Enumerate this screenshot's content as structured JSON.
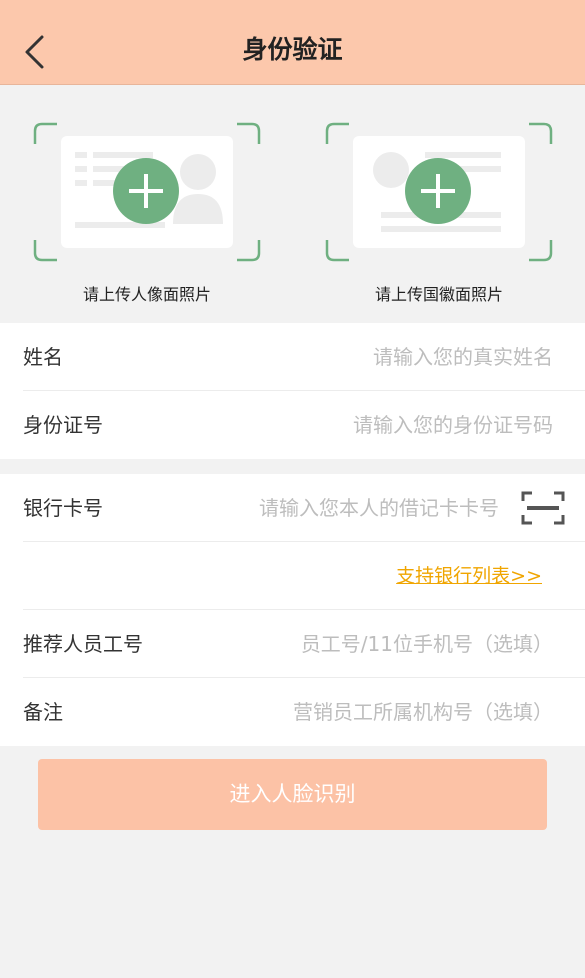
{
  "header": {
    "title": "身份验证"
  },
  "upload": {
    "portrait_label": "请上传人像面照片",
    "emblem_label": "请上传国徽面照片"
  },
  "identity": {
    "name_label": "姓名",
    "name_placeholder": "请输入您的真实姓名",
    "id_label": "身份证号",
    "id_placeholder": "请输入您的身份证号码"
  },
  "bank": {
    "card_label": "银行卡号",
    "card_placeholder": "请输入您本人的借记卡卡号",
    "bank_list_link": "支持银行列表>>",
    "referrer_label": "推荐人员工号",
    "referrer_placeholder": "员工号/11位手机号（选填）",
    "remark_label": "备注",
    "remark_placeholder": "营销员工所属机构号（选填）"
  },
  "submit": {
    "label": "进入人脸识别"
  },
  "colors": {
    "header_bg": "#fcc8ac",
    "accent_green": "#6fb081",
    "link_yellow": "#f0a500",
    "button_bg": "#fcc2a6"
  }
}
